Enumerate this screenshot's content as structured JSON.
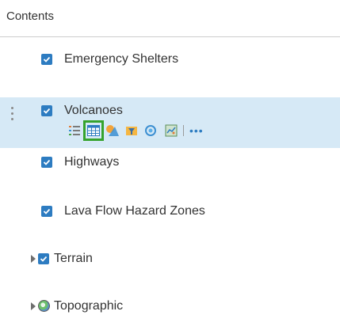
{
  "panel": {
    "title": "Contents"
  },
  "layers": [
    {
      "label": "Emergency Shelters",
      "checked": true
    },
    {
      "label": "Volcanoes",
      "checked": true,
      "selected": true
    },
    {
      "label": "Highways",
      "checked": true
    },
    {
      "label": "Lava Flow Hazard Zones",
      "checked": true
    },
    {
      "label": "Terrain",
      "checked": true,
      "expandable": true
    },
    {
      "label": "Topographic",
      "basemap": true,
      "expandable": true
    }
  ],
  "toolbar": {
    "icons": [
      "legend-icon",
      "attribute-table-icon",
      "change-style-icon",
      "filter-icon",
      "perform-analysis-icon",
      "show-table-icon"
    ],
    "more_label": "•••"
  },
  "colors": {
    "accent": "#2d7cc1",
    "selected_row": "#d6e9f6",
    "highlight": "#35a32d"
  }
}
